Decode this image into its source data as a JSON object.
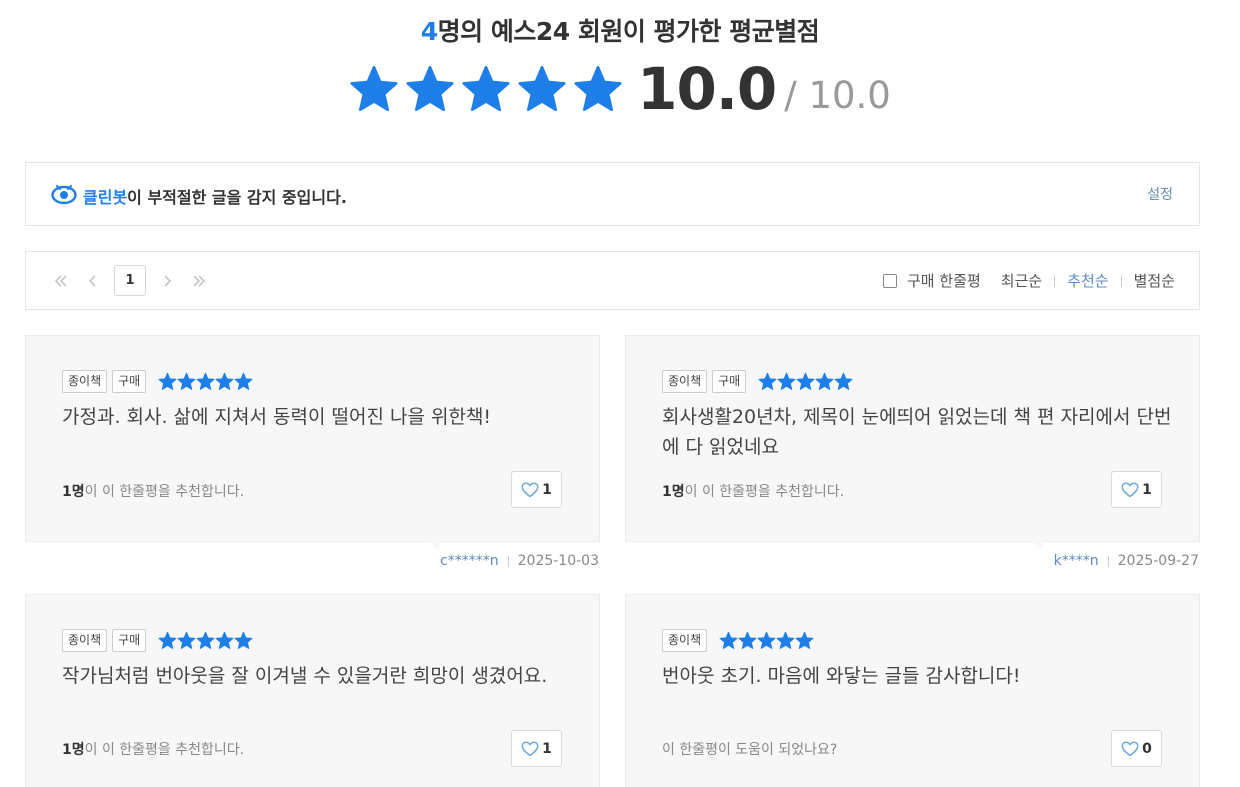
{
  "rating": {
    "count": "4",
    "title_suffix": "명의 예스24 회원이 평가한 평균별점",
    "score": "10.0",
    "max": "/ 10.0",
    "stars_filled": 5,
    "star_color": "#1f7fe8"
  },
  "cleanbot": {
    "brand": "클린봇",
    "message": "이 부적절한 글을 감지 중입니다.",
    "setting_label": "설정"
  },
  "toolbar": {
    "current_page": "1",
    "purchase_filter_label": "구매 한줄평",
    "sort_options": [
      {
        "label": "최근순",
        "active": false
      },
      {
        "label": "추천순",
        "active": true
      },
      {
        "label": "별점순",
        "active": false
      }
    ]
  },
  "reviews": [
    {
      "tags": [
        "종이책",
        "구매"
      ],
      "rating": 5,
      "text": "가정과. 회사. 삶에 지쳐서 동력이 떨어진 나을 위한책!",
      "recommend_count": "1명",
      "recommend_text": "이 이 한줄평을 추천합니다.",
      "likes": "1",
      "user": "c******n",
      "date": "2025-10-03"
    },
    {
      "tags": [
        "종이책",
        "구매"
      ],
      "rating": 5,
      "text": "회사생활20년차, 제목이 눈에띄어 읽었는데 책 편 자리에서 단번에 다 읽었네요",
      "recommend_count": "1명",
      "recommend_text": "이 이 한줄평을 추천합니다.",
      "likes": "1",
      "user": "k****n",
      "date": "2025-09-27"
    },
    {
      "tags": [
        "종이책",
        "구매"
      ],
      "rating": 5,
      "text": "작가님처럼 번아웃을 잘 이겨낼 수 있을거란 희망이 생겼어요.",
      "recommend_count": "1명",
      "recommend_text": "이 이 한줄평을 추천합니다.",
      "likes": "1"
    },
    {
      "tags": [
        "종이책"
      ],
      "rating": 5,
      "text": "번아웃 초기. 마음에 와닿는 글들 감사합니다!",
      "recommend_count": "",
      "recommend_text": "이 한줄평이 도움이 되었나요?",
      "likes": "0"
    }
  ]
}
